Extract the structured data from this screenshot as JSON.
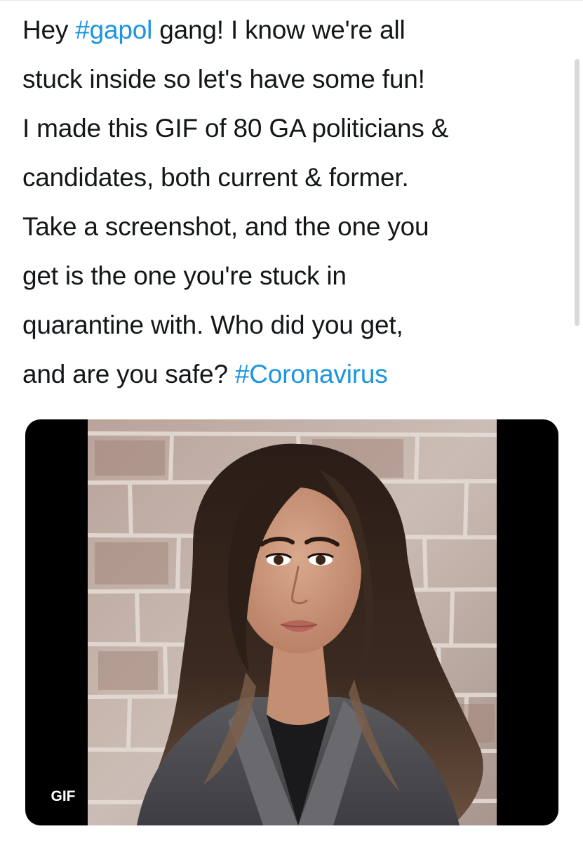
{
  "tweet": {
    "para1": [
      {
        "text": "Hey ",
        "hashtag": false
      },
      {
        "text": "#gapol",
        "hashtag": true
      },
      {
        "text": " gang! I know we're all",
        "hashtag": false
      },
      {
        "text": "stuck inside so let's have some fun!",
        "hashtag": false
      }
    ],
    "para2_lines": [
      "I made this GIF of 80 GA politicians &",
      "candidates, both current & former.",
      "Take a screenshot, and the one you",
      "get is the one you're stuck in",
      "quarantine with. Who did you get,"
    ],
    "para2_last_prefix": "and are you safe? ",
    "para2_last_hashtag": "#Coronavirus"
  },
  "media": {
    "badge": "GIF",
    "image_kind": "portrait-photo"
  },
  "colors": {
    "hashtag": "#1b95e0",
    "text": "#14171a",
    "media_background": "#000000"
  }
}
